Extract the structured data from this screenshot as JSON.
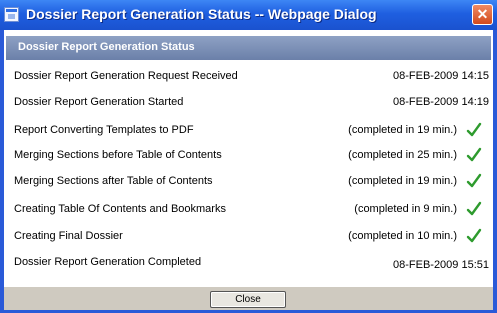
{
  "window": {
    "title": "Dossier Report Generation Status -- Webpage Dialog",
    "close_glyph": "✕"
  },
  "header": {
    "title": "Dossier Report Generation Status"
  },
  "rows": [
    {
      "label": "Dossier Report Generation Request Received",
      "value": "08-FEB-2009  14:15",
      "status": "timestamp"
    },
    {
      "label": "Dossier Report Generation Started",
      "value": "08-FEB-2009  14:19",
      "status": "timestamp"
    },
    {
      "label": "Report Converting Templates to PDF",
      "value": "(completed in 19 min.)",
      "status": "completed"
    },
    {
      "label": "Merging Sections before Table of Contents",
      "value": "(completed in 25 min.)",
      "status": "completed"
    },
    {
      "label": "Merging Sections after Table of Contents",
      "value": "(completed in 19 min.)",
      "status": "completed"
    },
    {
      "label": "Creating Table Of Contents and Bookmarks",
      "value": "(completed in 9 min.)",
      "status": "completed"
    },
    {
      "label": "Creating Final Dossier",
      "value": "(completed in 10 min.)",
      "status": "completed"
    },
    {
      "label": "Dossier Report Generation Completed",
      "value": "08-FEB-2009  15:51",
      "status": "timestamp"
    }
  ],
  "footer": {
    "close_label": "Close"
  },
  "colors": {
    "titlebar": "#1f5fe0",
    "header": "#7a8db5",
    "check": "#2e9b2e",
    "footer": "#cfcac0"
  },
  "icons": {
    "window_icon": "dialog-page-icon",
    "close_icon": "close-icon",
    "status_icon": "checkmark-icon"
  }
}
